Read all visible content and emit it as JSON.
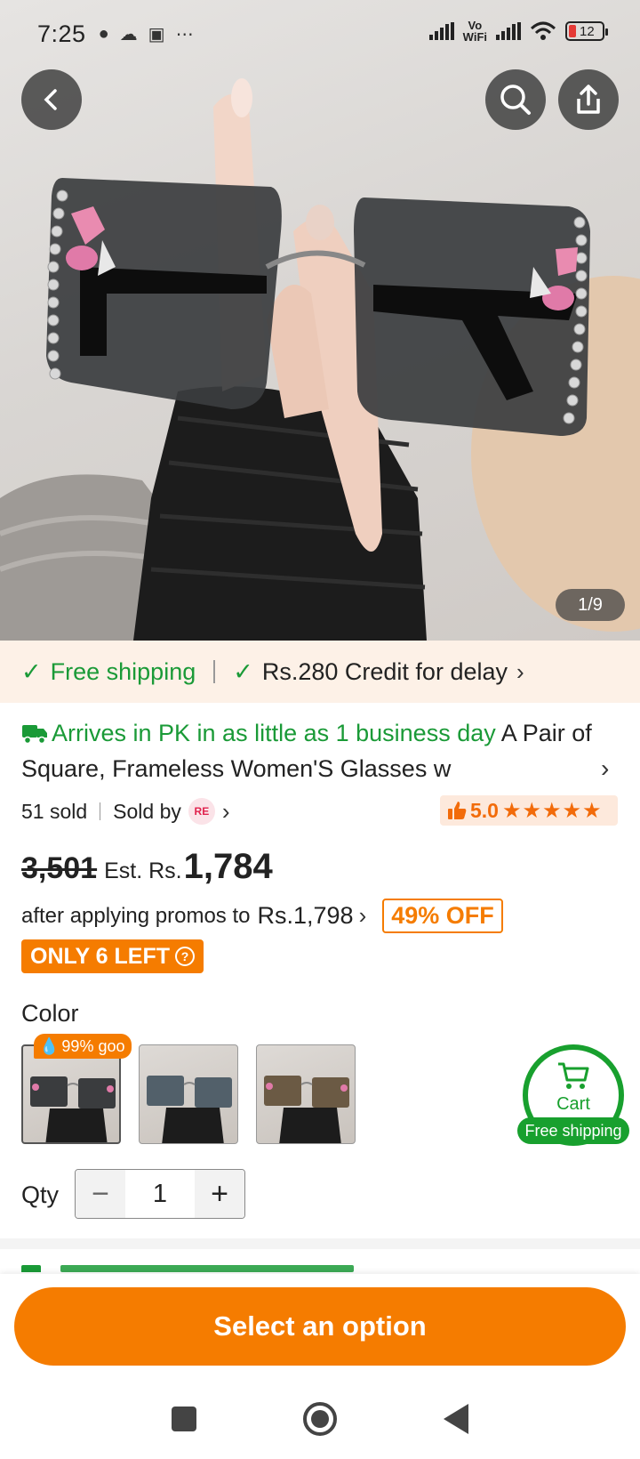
{
  "status_bar": {
    "time": "7:25",
    "network_label": "Vo\nWiFi",
    "battery": "12"
  },
  "gallery": {
    "counter": "1/9"
  },
  "shipping": {
    "free_label": "Free shipping",
    "credit_label": "Rs.280 Credit for delay"
  },
  "product": {
    "arrives_text": "Arrives in PK in as little as 1 business day",
    "title": "A Pair of Square, Frameless Women'S Glasses w",
    "sold_count": "51 sold",
    "sold_by_label": "Sold by",
    "seller_badge": "RE",
    "rating": "5.0",
    "stars": "★★★★★"
  },
  "price": {
    "original": "3,501",
    "est_label": "Est. Rs.",
    "est_value": "1,784",
    "promo_text": "after applying promos to",
    "promo_price": "Rs.1,798",
    "off_badge": "49% OFF",
    "stock_badge": "ONLY 6 LEFT"
  },
  "color": {
    "label": "Color",
    "good_tag": "99% goo"
  },
  "cart": {
    "label": "Cart",
    "shipping": "Free shipping"
  },
  "qty": {
    "label": "Qty",
    "minus": "−",
    "value": "1",
    "plus": "+"
  },
  "action": {
    "select_label": "Select an option"
  },
  "colors": {
    "accent_orange": "#f57c00",
    "green": "#1a9a37",
    "cart_green": "#18a02e",
    "strip_bg": "#fdf1e7"
  }
}
